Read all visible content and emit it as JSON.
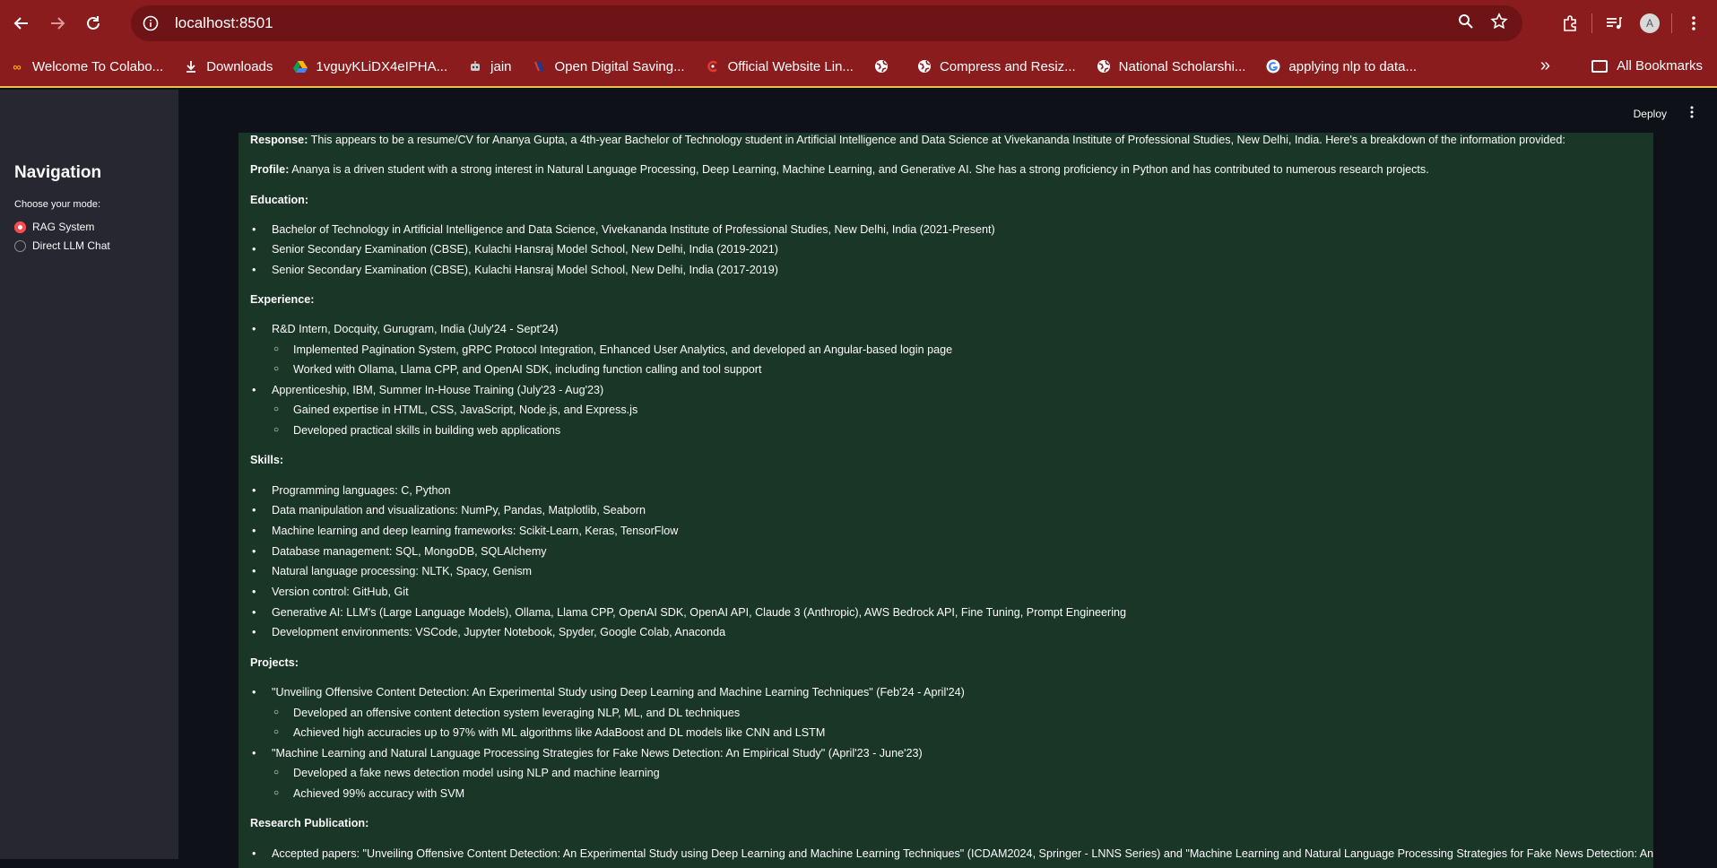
{
  "browser": {
    "url": "localhost:8501",
    "bookmarks": [
      {
        "label": "Welcome To Colabo...",
        "icon": "colab-icon"
      },
      {
        "label": "Downloads",
        "icon": "download-icon"
      },
      {
        "label": "1vguyKLiDX4eIPHA...",
        "icon": "google-drive-icon"
      },
      {
        "label": "jain",
        "icon": "robot-icon"
      },
      {
        "label": "Open Digital Saving...",
        "icon": "bank-icon"
      },
      {
        "label": "Official Website Lin...",
        "icon": "link-icon"
      },
      {
        "label": "",
        "icon": "globe-icon"
      },
      {
        "label": "Compress and Resiz...",
        "icon": "globe-icon"
      },
      {
        "label": "National Scholarshi...",
        "icon": "globe-icon"
      },
      {
        "label": "applying nlp to data...",
        "icon": "google-icon"
      }
    ],
    "all_bookmarks": "All Bookmarks",
    "avatar_initial": "A"
  },
  "sidebar": {
    "title": "Navigation",
    "mode_label": "Choose your mode:",
    "options": [
      {
        "label": "RAG System",
        "selected": true
      },
      {
        "label": "Direct LLM Chat",
        "selected": false
      }
    ]
  },
  "header": {
    "deploy": "Deploy"
  },
  "response": {
    "intro_label": "Response:",
    "intro_text": " This appears to be a resume/CV for Ananya Gupta, a 4th-year Bachelor of Technology student in Artificial Intelligence and Data Science at Vivekananda Institute of Professional Studies, New Delhi, India. Here's a breakdown of the information provided:",
    "profile_label": "Profile:",
    "profile_text": " Ananya is a driven student with a strong interest in Natural Language Processing, Deep Learning, Machine Learning, and Generative AI. She has a strong proficiency in Python and has contributed to numerous research projects.",
    "education_heading": "Education:",
    "education": [
      "Bachelor of Technology in Artificial Intelligence and Data Science, Vivekananda Institute of Professional Studies, New Delhi, India (2021-Present)",
      "Senior Secondary Examination (CBSE), Kulachi Hansraj Model School, New Delhi, India (2019-2021)",
      "Senior Secondary Examination (CBSE), Kulachi Hansraj Model School, New Delhi, India (2017-2019)"
    ],
    "experience_heading": "Experience:",
    "exp1": "R&D Intern, Docquity, Gurugram, India (July'24 - Sept'24)",
    "exp1_a": "Implemented Pagination System, gRPC Protocol Integration, Enhanced User Analytics, and developed an Angular-based login page",
    "exp1_b": "Worked with Ollama, Llama CPP, and OpenAI SDK, including function calling and tool support",
    "exp2": "Apprenticeship, IBM, Summer In-House Training (July'23 - Aug'23)",
    "exp2_a": "Gained expertise in HTML, CSS, JavaScript, Node.js, and Express.js",
    "exp2_b": "Developed practical skills in building web applications",
    "skills_heading": "Skills:",
    "skills": [
      "Programming languages: C, Python",
      "Data manipulation and visualizations: NumPy, Pandas, Matplotlib, Seaborn",
      "Machine learning and deep learning frameworks: Scikit-Learn, Keras, TensorFlow",
      "Database management: SQL, MongoDB, SQLAlchemy",
      "Natural language processing: NLTK, Spacy, Genism",
      "Version control: GitHub, Git",
      "Generative AI: LLM's (Large Language Models), Ollama, Llama CPP, OpenAI SDK, OpenAI API, Claude 3 (Anthropic), AWS Bedrock API, Fine Tuning, Prompt Engineering",
      "Development environments: VSCode, Jupyter Notebook, Spyder, Google Colab, Anaconda"
    ],
    "projects_heading": "Projects:",
    "proj1": "\"Unveiling Offensive Content Detection: An Experimental Study using Deep Learning and Machine Learning Techniques\" (Feb'24 - April'24)",
    "proj1_a": "Developed an offensive content detection system leveraging NLP, ML, and DL techniques",
    "proj1_b": "Achieved high accuracies up to 97% with ML algorithms like AdaBoost and DL models like CNN and LSTM",
    "proj2": "\"Machine Learning and Natural Language Processing Strategies for Fake News Detection: An Empirical Study\" (April'23 - June'23)",
    "proj2_a": "Developed a fake news detection model using NLP and machine learning",
    "proj2_b": "Achieved 99% accuracy with SVM",
    "research_heading": "Research Publication:",
    "research1": "Accepted papers: \"Unveiling Offensive Content Detection: An Experimental Study using Deep Learning and Machine Learning Techniques\" (ICDAM2024, Springer - LNNS Series) and \"Machine Learning and Natural Language Processing Strategies for Fake News Detection: An"
  }
}
